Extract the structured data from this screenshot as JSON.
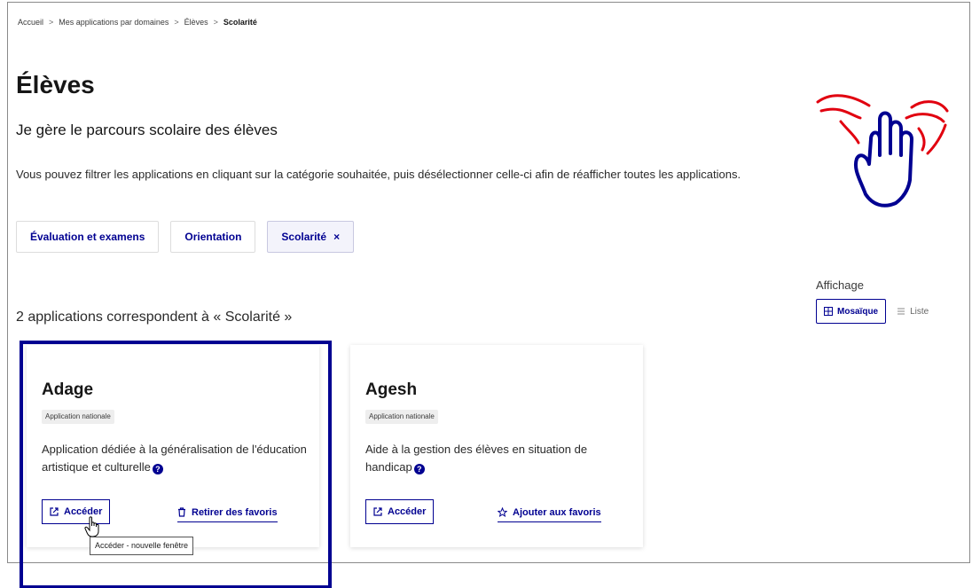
{
  "breadcrumb": {
    "items": [
      "Accueil",
      "Mes applications par domaines",
      "Élèves",
      "Scolarité"
    ],
    "separator": ">"
  },
  "page": {
    "title": "Élèves",
    "subtitle": "Je gère le parcours scolaire des élèves",
    "description": "Vous pouvez filtrer les applications en cliquant sur la catégorie souhaitée, puis désélectionner celle-ci afin de réafficher toutes les applications."
  },
  "filters": {
    "tags": [
      {
        "label": "Évaluation et examens",
        "active": false
      },
      {
        "label": "Orientation",
        "active": false
      },
      {
        "label": "Scolarité",
        "active": true,
        "remove_icon": "×"
      }
    ]
  },
  "display": {
    "label": "Affichage",
    "options": [
      {
        "label": "Mosaïque",
        "icon": "grid-icon",
        "selected": true
      },
      {
        "label": "Liste",
        "icon": "list-icon",
        "selected": false
      }
    ]
  },
  "results": {
    "count_text": "2 applications correspondent à « Scolarité »"
  },
  "cards": [
    {
      "title": "Adage",
      "badge": "Application nationale",
      "description": "Application dédiée à la généralisation de l'éducation artistique et culturelle",
      "access_label": "Accéder",
      "favorite_label": "Retirer des favoris",
      "favorite_icon": "trash-icon"
    },
    {
      "title": "Agesh",
      "badge": "Application nationale",
      "description": "Aide à la gestion des élèves en situation de handicap",
      "access_label": "Accéder",
      "favorite_label": "Ajouter aux favoris",
      "favorite_icon": "star-icon"
    }
  ],
  "tooltip": {
    "text": "Accéder - nouvelle fenêtre"
  },
  "colors": {
    "accent": "#000091",
    "illustration_red": "#e1000f",
    "text": "#161616"
  }
}
